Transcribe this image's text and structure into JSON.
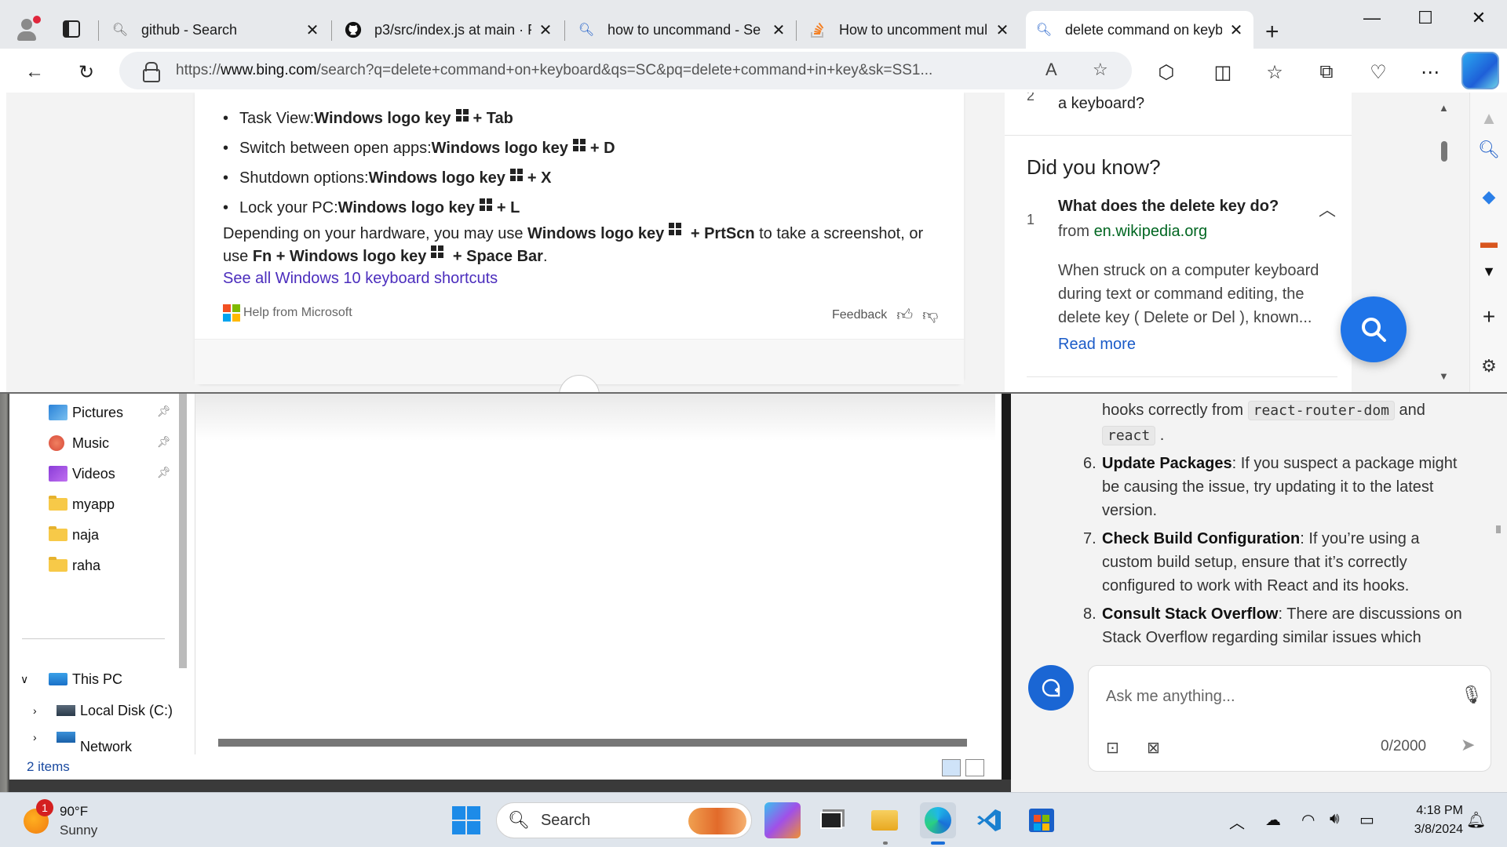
{
  "browser": {
    "tabs": [
      {
        "title": "github - Search",
        "icon": "bing-search-icon"
      },
      {
        "title": "p3/src/index.js at main · P",
        "icon": "github-icon"
      },
      {
        "title": "how to uncommand - Se",
        "icon": "bing-search-icon"
      },
      {
        "title": "How to uncomment mul",
        "icon": "stackoverflow-icon"
      },
      {
        "title": "delete command on keyb",
        "icon": "bing-search-icon",
        "active": true
      }
    ],
    "url_prefix": "https://",
    "url_host": "www.bing.com",
    "url_rest": "/search?q=delete+command+on+keyboard&qs=SC&pq=delete+command+in+key&sk=SS1..."
  },
  "answer": {
    "shortcuts": [
      {
        "label": "Task View: ",
        "key": "Windows logo key",
        "combo": " + Tab"
      },
      {
        "label": "Switch between open apps: ",
        "key": "Windows logo key",
        "combo": " + D"
      },
      {
        "label": "Shutdown options: ",
        "key": "Windows logo key",
        "combo": " + X"
      },
      {
        "label": "Lock your PC: ",
        "key": "Windows logo key",
        "combo": " + L"
      }
    ],
    "para_1": "Depending on your hardware, you may use ",
    "para_key1": "Windows logo key",
    "para_combo1": " + PrtScn",
    "para_2": " to take a screenshot, or use ",
    "para_fn": "Fn + Windows logo key",
    "para_combo2": " + Space Bar",
    "para_end": ".",
    "see_all": "See all Windows 10 keyboard shortcuts",
    "help_from": "Help from Microsoft",
    "feedback": "Feedback"
  },
  "side": {
    "prev_num": "2",
    "prev_text": "a keyboard?",
    "heading": "Did you know?",
    "q_num": "1",
    "question": "What does the delete key do?",
    "from_label": "from ",
    "from_source": "en.wikipedia.org",
    "description": "When struck on a computer keyboard during text or command editing, the delete key ( Delete or Del ), known...",
    "read_more": "Read more"
  },
  "explorer": {
    "nav": [
      {
        "label": "Pictures",
        "icon": "pictures-icon",
        "pinned": true
      },
      {
        "label": "Music",
        "icon": "music-icon",
        "pinned": true
      },
      {
        "label": "Videos",
        "icon": "videos-icon",
        "pinned": true
      },
      {
        "label": "myapp",
        "icon": "folder-icon",
        "pinned": false
      },
      {
        "label": "naja",
        "icon": "folder-icon",
        "pinned": false
      },
      {
        "label": "raha",
        "icon": "folder-icon",
        "pinned": false
      }
    ],
    "this_pc": "This PC",
    "local_disk": "Local Disk (C:)",
    "network": "Network",
    "status": "2 items"
  },
  "chat": {
    "l1_a": "hooks correctly from ",
    "l1_code": "react-router-dom",
    "l1_b": " and",
    "l2_code": "react",
    "l2_b": " .",
    "item6_num": "6.",
    "item6_title": "Update Packages",
    "item6_l1": ": If you suspect a package might",
    "item6_l2": "be causing the issue, try updating it to the latest",
    "item6_l3": "version.",
    "item7_num": "7.",
    "item7_title": "Check Build Configuration",
    "item7_l1": ": If you’re using a",
    "item7_l2": "custom build setup, ensure that it’s correctly",
    "item7_l3": "configured to work with React and its hooks.",
    "item8_num": "8.",
    "item8_title": "Consult Stack Overflow",
    "item8_l1": ": There are discussions on",
    "item8_l2": "Stack Overflow regarding similar issues which",
    "placeholder": "Ask me anything...",
    "count": "0/2000"
  },
  "taskbar": {
    "weather_badge": "1",
    "temp": "90°F",
    "condition": "Sunny",
    "search": "Search",
    "time": "4:18 PM",
    "date": "3/8/2024"
  },
  "colors": {
    "accent": "#1a66d4",
    "link_purple": "#4b2dbd",
    "source_green": "#006621"
  }
}
